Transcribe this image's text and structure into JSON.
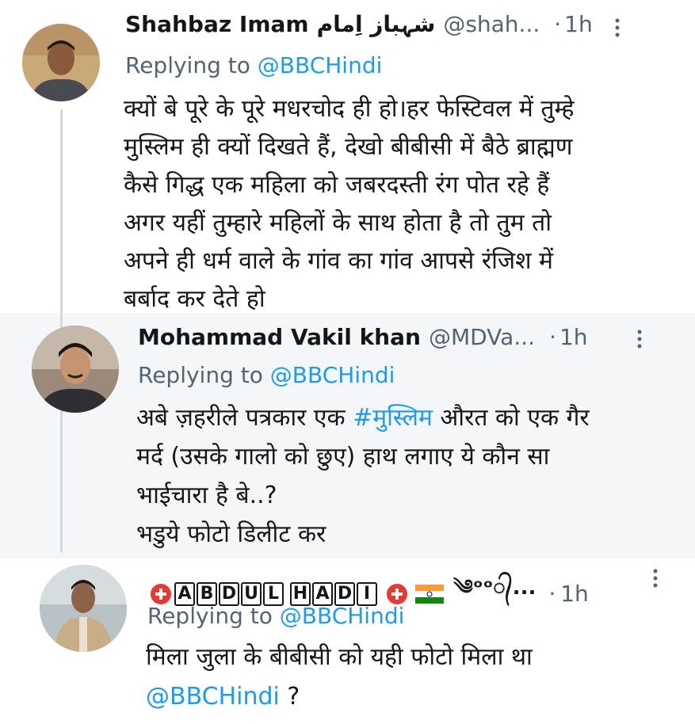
{
  "tweets": [
    {
      "name": "Shahbaz Imam",
      "name_urdu": "شہباز اِمام",
      "handle": "@shah...",
      "separator": "·",
      "time": "1h",
      "replying_label": "Replying to",
      "replying_mention": "@BBCHindi",
      "body_lines": [
        "क्यों बे पूरे के पूरे मधरचोद ही हो।हर फेस्टिवल में तुम्हे",
        "मुस्लिम ही क्यों दिखते हैं, देखो बीबीसी में बैठे ब्राह्मण",
        "कैसे गिद्ध एक महिला को जबरदस्ती रंग पोत रहे हैं",
        "अगर यहीं तुम्हारे महिलों के साथ होता है तो तुम तो",
        "अपने ही धर्म वाले के गांव का गांव आपसे रंजिश में",
        "बर्बाद कर देते हो"
      ]
    },
    {
      "name": "Mohammad Vakil khan",
      "handle": "@MDVa...",
      "separator": "·",
      "time": "1h",
      "replying_label": "Replying to",
      "replying_mention": "@BBCHindi",
      "body_line1_pre": "अबे ज़हरीले पत्रकार एक ",
      "body_line1_tag": "#मुस्लिम",
      "body_line1_post": " औरत को एक गैर",
      "body_lines_rest": [
        "मर्द (उसके गालो को छुए) हाथ लगाए ये कौन सा",
        "भाईचारा है बे..?",
        "भडुये फोटो डिलीट कर"
      ]
    },
    {
      "name_first": "ABDUL",
      "name_last": "HADI",
      "name_tail": "༄ᵒᵒ᭄...",
      "separator": "·",
      "time": "1h",
      "replying_label": "Replying to",
      "replying_mention": "@BBCHindi",
      "body_line1": "मिला जुला के बीबीसी को यही फोटो मिला था",
      "body_link": "@BBCHindi",
      "body_tail": " ?"
    }
  ],
  "icons": {
    "more": "more-vertical-icon",
    "medic": "red-helmet-icon",
    "flag": "india-flag-icon"
  },
  "colors": {
    "link": "#1d9bf0",
    "secondary": "#536471",
    "thread_line": "#cfd9de"
  }
}
